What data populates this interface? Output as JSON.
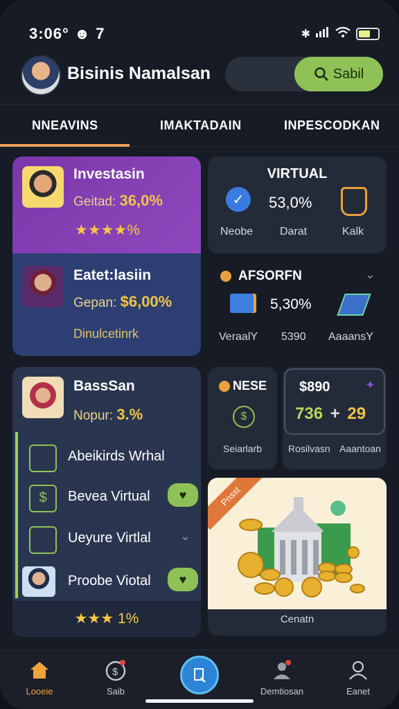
{
  "status": {
    "time": "3:06° ☻ 7"
  },
  "header": {
    "name": "Bisinis Namalsan",
    "search_label": "Sabil"
  },
  "tabs": [
    "NNEAVINS",
    "IMAKTADAIN",
    "INPESCODKAN"
  ],
  "card_invest": {
    "title": "Investasin",
    "label": "Geitad:",
    "value": "36,0%",
    "rating": "★★★★%"
  },
  "card_eatet": {
    "title": "Eatet:lasiin",
    "label": "Gepan:",
    "value": "$6,00%",
    "footer": "Dinulcetinrk"
  },
  "card_virtual": {
    "title": "VIRTUAL",
    "value": "53,0%",
    "labels": [
      "Neobe",
      "Darat",
      "Kalk"
    ]
  },
  "card_afsoren": {
    "title": "AFSORFN",
    "value": "5,30%",
    "labels": [
      "VeraalY",
      "5390",
      "AaaansY"
    ]
  },
  "card_bassan": {
    "title": "BassSan",
    "label": "Nopur:",
    "value": "3.%",
    "items": [
      "Abeikirds Wrhal",
      "Bevea Virtual",
      "Ueyure Virtlal",
      "Proobe Viotal"
    ],
    "rating": "★★★ 1%"
  },
  "card_nese": {
    "title": "NESE",
    "footer": "Seiarlarb"
  },
  "card_price": {
    "price": "$890",
    "stat_a": "736",
    "plus": "+",
    "stat_b": "29",
    "footer_a": "Rosilvasn",
    "footer_b": "Aaantoan"
  },
  "card_banner": {
    "ribbon": "Pnsst",
    "caption": "Cenatn"
  },
  "nav": [
    "Looeie",
    "Saib",
    "",
    "Demtiosan",
    "Eanet"
  ],
  "colors": {
    "accent": "#e7a25a",
    "green": "#8fc256",
    "purple": "#7c3dab",
    "navy": "#2d3f72"
  }
}
